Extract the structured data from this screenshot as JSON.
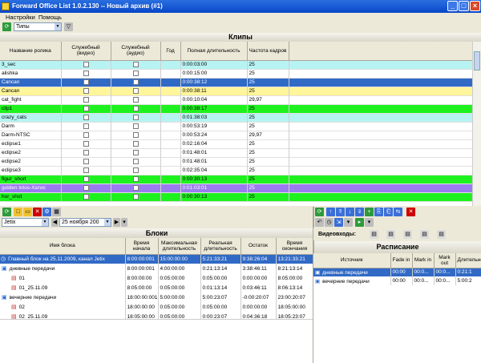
{
  "window": {
    "title": "Forward Office List 1.0.2.130 -- Новый архив (#1)"
  },
  "menu": [
    "Настройки",
    "Помощь"
  ],
  "toolbar": {
    "type_filter": "Типы"
  },
  "clips": {
    "title": "Клипы",
    "columns": [
      "Название ролика",
      "Служебный (видео)",
      "Служебный (аудио)",
      "Год",
      "Полная длительность",
      "Частота кадров"
    ],
    "rows": [
      {
        "name": "3_sec",
        "duration": "0:00:03:00",
        "fps": "25",
        "bg": "#b7f3f3",
        "fg": "#000"
      },
      {
        "name": "alishka",
        "duration": "0:00:15:00",
        "fps": "25",
        "bg": "#ffffff",
        "fg": "#000"
      },
      {
        "name": "Cancan",
        "duration": "0:00:38:12",
        "fps": "25",
        "bg": "#316ac5",
        "fg": "#fff"
      },
      {
        "name": "Cancan",
        "duration": "0:00:38:11",
        "fps": "25",
        "bg": "#fff59a",
        "fg": "#000"
      },
      {
        "name": "cat_fight",
        "duration": "0:00:10:04",
        "fps": "29,97",
        "bg": "#ffffff",
        "fg": "#000"
      },
      {
        "name": "clip1",
        "duration": "0:00:38:17",
        "fps": "25",
        "bg": "#1ef21e",
        "fg": "#000"
      },
      {
        "name": "crazy_cats",
        "duration": "0:01:38:03",
        "fps": "25",
        "bg": "#b7f3f3",
        "fg": "#000"
      },
      {
        "name": "Darm",
        "duration": "0:00:53:19",
        "fps": "25",
        "bg": "#ffffff",
        "fg": "#000"
      },
      {
        "name": "Darm-NTSC",
        "duration": "0:00:53:24",
        "fps": "29,97",
        "bg": "#ffffff",
        "fg": "#000"
      },
      {
        "name": "eclipse1",
        "duration": "0:02:16:04",
        "fps": "25",
        "bg": "#ffffff",
        "fg": "#000"
      },
      {
        "name": "eclipse2",
        "duration": "0:01:48:01",
        "fps": "25",
        "bg": "#ffffff",
        "fg": "#000"
      },
      {
        "name": "eclipse2",
        "duration": "0:01:48:01",
        "fps": "25",
        "bg": "#ffffff",
        "fg": "#000"
      },
      {
        "name": "eclipse3",
        "duration": "0:02:35:04",
        "fps": "25",
        "bg": "#ffffff",
        "fg": "#000"
      },
      {
        "name": "figur_short",
        "duration": "0:00:30:13",
        "fps": "25",
        "bg": "#1ef21e",
        "fg": "#000"
      },
      {
        "name": "golden lotos-Хатис",
        "duration": "0:01:03:01",
        "fps": "25",
        "bg": "#9b7cf0",
        "fg": "#fff"
      },
      {
        "name": "hor_shot",
        "duration": "0:00:30:13",
        "fps": "25",
        "bg": "#1ef21e",
        "fg": "#000"
      }
    ]
  },
  "blocks_toolbar": {
    "channel": "Jetix",
    "date": "25  ноября  200"
  },
  "blocks": {
    "title": "Блоки",
    "columns": [
      "Имя блока",
      "Время начала",
      "Максимальная длительность",
      "Реальная длительность",
      "Остаток",
      "Время окончания"
    ],
    "rows": [
      {
        "name": "Главный блок на 25.11.2009, канал Jetix",
        "start": "8:00:00:001",
        "max": "15:00:00:00",
        "real": "5:21:33:21",
        "rest": "9:38:26:04",
        "end": "13:21:33:21",
        "indent": 0,
        "icon": "clock",
        "bg": "#316ac5",
        "fg": "#fff"
      },
      {
        "name": "дневные передачи",
        "start": "8:00:00:001",
        "max": "4:00:00:00",
        "real": "0:21:13:14",
        "rest": "3:38:46:11",
        "end": "8:21:13:14",
        "indent": 1,
        "icon": "tv",
        "bg": "#ffffff",
        "fg": "#000"
      },
      {
        "name": "01",
        "start": "8:00:00:00",
        "max": "0:05:00:00",
        "real": "0:05:00:00",
        "rest": "0:00:00:00",
        "end": "8:05:00:00",
        "indent": 2,
        "icon": "film",
        "bg": "#ffffff",
        "fg": "#000"
      },
      {
        "name": "01_25.11.09",
        "start": "8:05:00:00",
        "max": "0:05:00:00",
        "real": "0:01:13:14",
        "rest": "0:03:46:11",
        "end": "8:06:13:14",
        "indent": 2,
        "icon": "film",
        "bg": "#ffffff",
        "fg": "#000"
      },
      {
        "name": "вечерние передачи",
        "start": "18:00:00:001",
        "max": "5:00:00:00",
        "real": "5:00:23:07",
        "rest": "-0:00:20:07",
        "end": "23:00:20:07",
        "indent": 1,
        "icon": "tv",
        "bg": "#ffffff",
        "fg": "#000"
      },
      {
        "name": "02",
        "start": "18:00:00:00",
        "max": "0:05:00:00",
        "real": "0:05:00:00",
        "rest": "0:00:00:00",
        "end": "18:05:00:00",
        "indent": 2,
        "icon": "film",
        "bg": "#ffffff",
        "fg": "#000"
      },
      {
        "name": "02_25.11.09",
        "start": "18:05:00:00",
        "max": "0:05:00:00",
        "real": "0:00:23:07",
        "rest": "0:04:36:18",
        "end": "18:05:23:07",
        "indent": 2,
        "icon": "film",
        "bg": "#ffffff",
        "fg": "#000"
      }
    ]
  },
  "video_inputs": {
    "label": "Видеовходы:",
    "count": 5
  },
  "schedule": {
    "title": "Расписание",
    "columns": [
      "Источник",
      "Fade in",
      "Mark in",
      "Mark out",
      "Длительность"
    ],
    "rows": [
      {
        "name": "дневные передачи",
        "fade": "00:00",
        "markin": "00:0...",
        "markout": "00:0...",
        "dur": "0:21:1",
        "bg": "#316ac5",
        "fg": "#fff"
      },
      {
        "name": "вечерние передачи",
        "fade": "00:00",
        "markin": "00:0...",
        "markout": "00:0...",
        "dur": "5:00:2",
        "bg": "#ffffff",
        "fg": "#000"
      }
    ]
  }
}
